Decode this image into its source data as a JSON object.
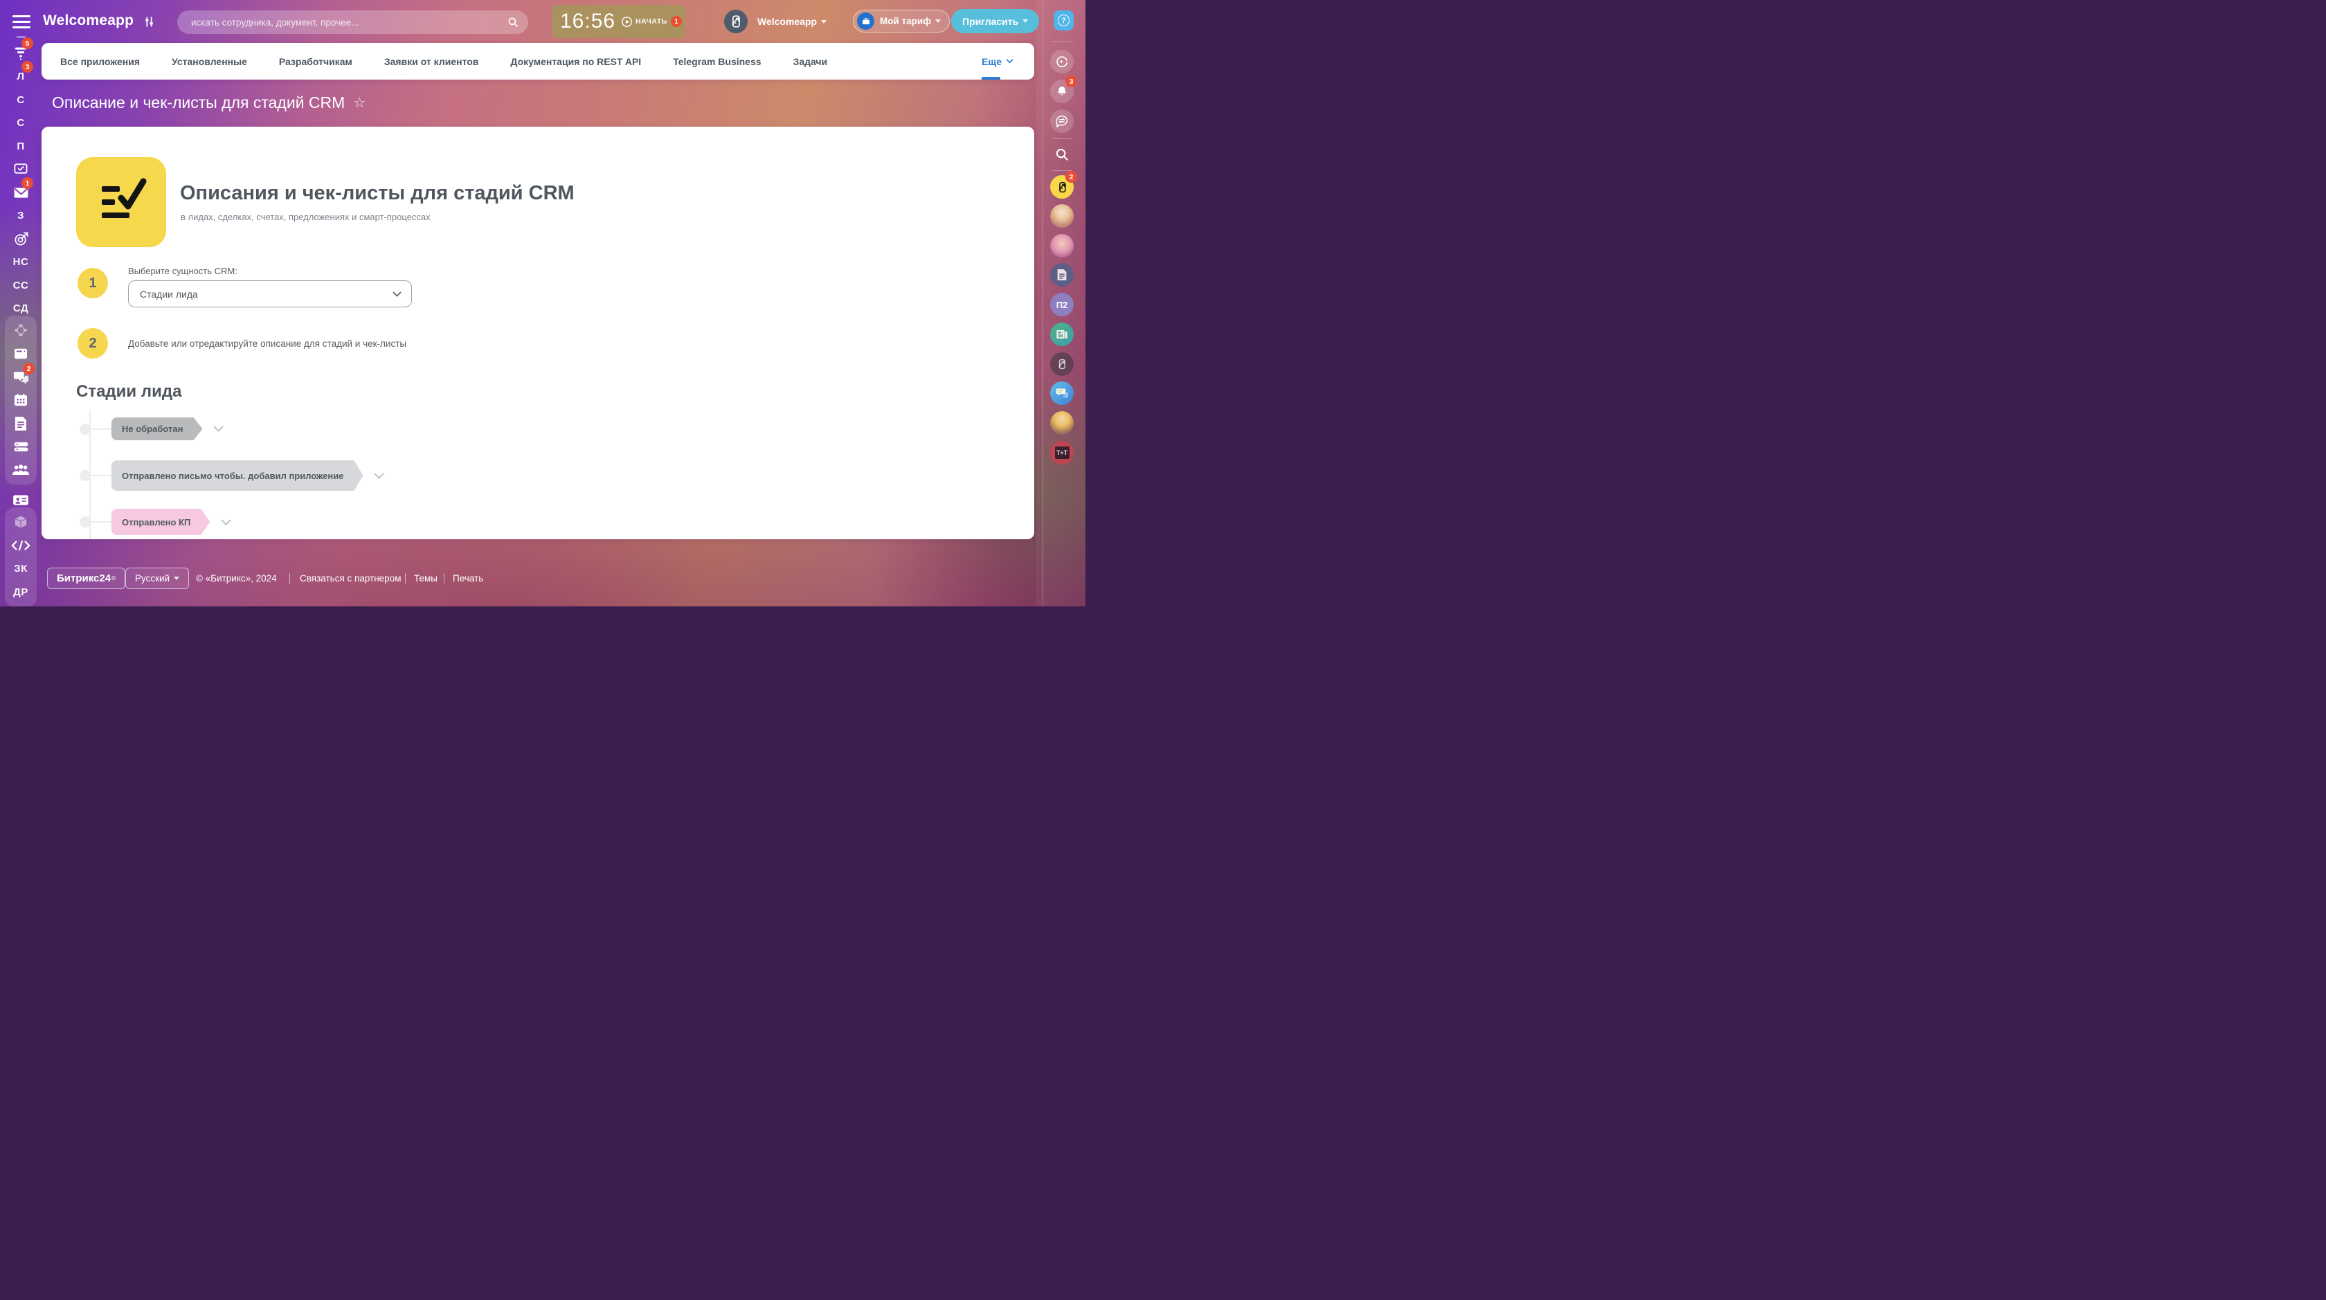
{
  "colors": {
    "accent_blue": "#2b7cd3",
    "invite_teal": "#57bedb",
    "help_blue": "#4fb5e8",
    "badge_red": "#e94e35",
    "step_yellow": "#f7d64f",
    "icon_yellow": "#f6d84c",
    "clock_tan": "#a7945d"
  },
  "header": {
    "app_title": "Welcomeapp",
    "search_placeholder": "искать сотрудника, документ, прочее...",
    "clock_time": "16:56",
    "start_label": "НАЧАТЬ",
    "start_badge": "1",
    "account_name": "Welcomeapp",
    "tariff_label": "Мой тариф",
    "invite_label": "Пригласить",
    "help_label": "?"
  },
  "left_sidebar": {
    "top_items": [
      {
        "icon": "filter-icon",
        "badge": "5"
      },
      {
        "label": "Л",
        "badge": "3"
      },
      {
        "label": "С"
      },
      {
        "label": "С"
      },
      {
        "label": "П"
      },
      {
        "icon": "monitor-check-icon"
      },
      {
        "icon": "mail-icon",
        "badge": "1"
      },
      {
        "label": "З"
      },
      {
        "icon": "target-icon"
      },
      {
        "label": "НС"
      },
      {
        "label": "СС"
      },
      {
        "label": "СД"
      }
    ],
    "group1_items": [
      {
        "icon": "network-icon"
      },
      {
        "icon": "browser-icon"
      },
      {
        "icon": "chat-icon",
        "badge": "2"
      },
      {
        "icon": "calendar-icon"
      },
      {
        "icon": "document-icon"
      },
      {
        "icon": "drive-icon"
      },
      {
        "icon": "people-icon"
      }
    ],
    "contact_item": {
      "icon": "contact-card-icon"
    },
    "group2_items": [
      {
        "icon": "cube-icon"
      },
      {
        "icon": "code-icon"
      },
      {
        "label": "ЗК"
      },
      {
        "label": "ДР"
      }
    ]
  },
  "nav": {
    "tabs": [
      "Все приложения",
      "Установленные",
      "Разработчикам",
      "Заявки от клиентов",
      "Документация по REST API",
      "Telegram Business",
      "Задачи"
    ],
    "more_label": "Еще"
  },
  "page": {
    "title": "Описание и чек-листы для стадий CRM",
    "star_icon": "☆"
  },
  "main": {
    "heading": "Описания и чек-листы для стадий CRM",
    "subtitle": "в лидах, сделках, счетах, предложениях и смарт-процессах",
    "step1": {
      "number": "1",
      "label": "Выберите сущность CRM:",
      "select_value": "Стадии лида"
    },
    "step2": {
      "number": "2",
      "label": "Добавьте или отредактируйте описание для стадий и чек-листы"
    },
    "section_title": "Стадии лида",
    "stages": [
      {
        "label": "Не обработан",
        "color": "#b9babc"
      },
      {
        "label": "Отправлено письмо чтобы. добавил приложение",
        "color": "#d6d8db"
      },
      {
        "label": "Отправлено КП",
        "color": "#f6c8e2"
      }
    ]
  },
  "right_sidebar": {
    "help_label": "?",
    "bell_badge": "3",
    "app_badge": "2",
    "p2_label": "П2",
    "tt_label": "T+T"
  },
  "footer": {
    "brand": "Битрикс24",
    "brand_mark": "©",
    "language": "Русский",
    "copyright": "© «Битрикс», 2024",
    "links": [
      "Связаться с партнером",
      "Темы",
      "Печать"
    ]
  }
}
